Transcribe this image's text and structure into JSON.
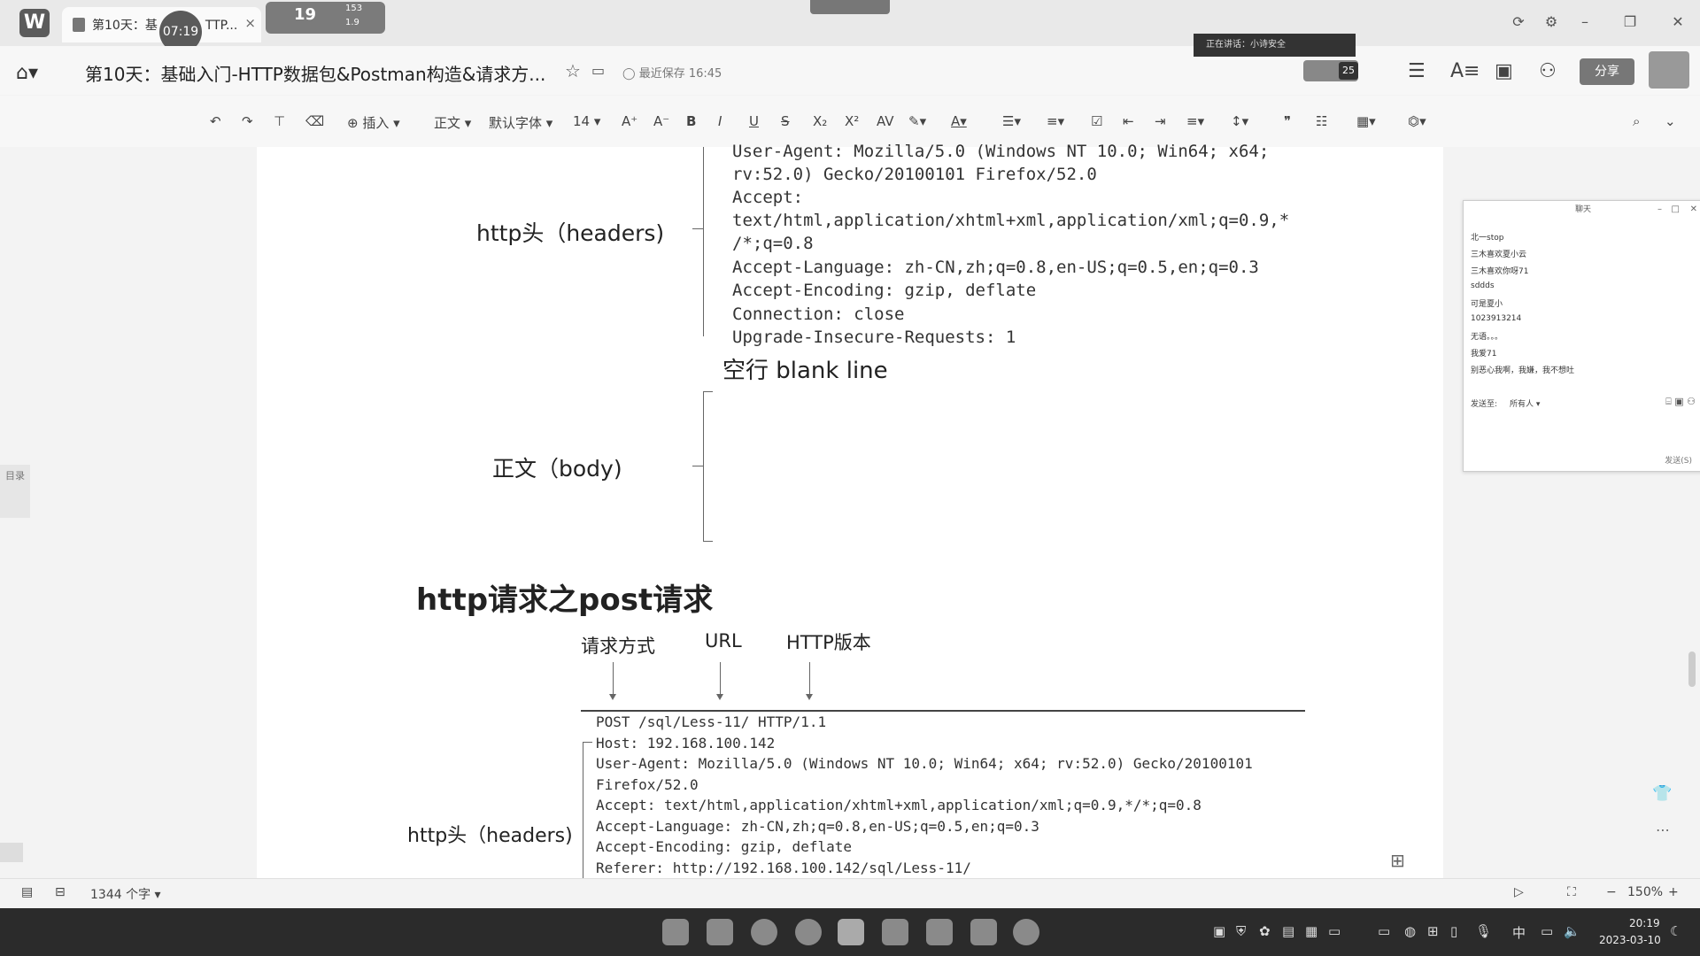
{
  "tab": {
    "title": "第10天：基",
    "title_suffix": "TTP...",
    "close": "×"
  },
  "timer": "07:19",
  "badge": {
    "number": "19",
    "line1": "153",
    "line2": "1.9"
  },
  "doc": {
    "title": "第10天：基础入门-HTTP数据包&Postman构造&请求方...",
    "saved": "最近保存 16:45"
  },
  "speaking": "正在讲话：小诗安全",
  "avatar_count": "25",
  "share_label": "分享",
  "toolbar": {
    "insert": "插入",
    "style": "正文",
    "font": "默认字体",
    "size": "14"
  },
  "content": {
    "get_lines": [
      "User-Agent: Mozilla/5.0 (Windows NT 10.0; Win64; x64;",
      "rv:52.0) Gecko/20100101 Firefox/52.0",
      "Accept:",
      "text/html,application/xhtml+xml,application/xml;q=0.9,*",
      "/*;q=0.8",
      "Accept-Language: zh-CN,zh;q=0.8,en-US;q=0.5,en;q=0.3",
      "Accept-Encoding: gzip, deflate",
      "Connection: close",
      "Upgrade-Insecure-Requests: 1"
    ],
    "headers_label": "http头（headers)",
    "blank_line": "空行 blank line",
    "body_label": "正文（body)",
    "post_heading": "http请求之post请求",
    "col_method": "请求方式",
    "col_url": "URL",
    "col_version": "HTTP版本",
    "post_lines": [
      "POST /sql/Less-11/ HTTP/1.1",
      "Host: 192.168.100.142",
      "User-Agent: Mozilla/5.0 (Windows NT 10.0; Win64; x64; rv:52.0) Gecko/20100101",
      "Firefox/52.0",
      "Accept: text/html,application/xhtml+xml,application/xml;q=0.9,*/*;q=0.8",
      "Accept-Language: zh-CN,zh;q=0.8,en-US;q=0.5,en;q=0.3",
      "Accept-Encoding: gzip, deflate",
      "Referer: http://192.168.100.142/sql/Less-11/"
    ],
    "headers_label2": "http头（headers)"
  },
  "outline_tab": "目录",
  "chat": {
    "title": "聊天",
    "messages": [
      "北一stop",
      "三木喜欢夏小云",
      "三木喜欢你呀71",
      "sddds",
      "可是夏小",
      "1023913214",
      "无语。。。",
      "我爱71",
      "别恶心我啊，我嫌，我不想吐"
    ],
    "to_label": "发送至:",
    "to_value": "所有人",
    "send": "发送(S)"
  },
  "status": {
    "word_count": "1344 个字",
    "zoom": "150%"
  },
  "clock": {
    "time": "20:19",
    "date": "2023-03-10"
  },
  "tray_lang": "中"
}
